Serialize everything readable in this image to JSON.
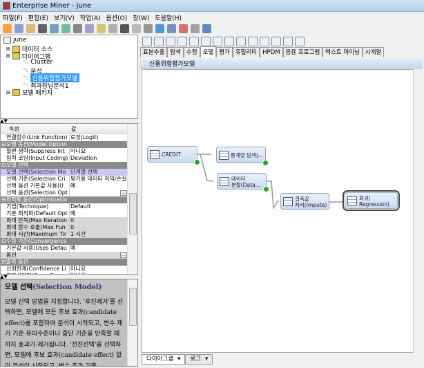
{
  "window": {
    "title": "Enterprise Miner - june"
  },
  "menu": [
    "파일(F)",
    "편집(E)",
    "보기(V)",
    "작업(A)",
    "옵션(O)",
    "창(W)",
    "도움말(H)"
  ],
  "tree": {
    "root": "june",
    "items": [
      {
        "label": "데이터 소스",
        "level": 1
      },
      {
        "label": "다이어그램",
        "level": 1
      },
      {
        "label": "Cluster",
        "level": 2
      },
      {
        "label": "분석",
        "level": 2
      },
      {
        "label": "신용위험평가모델",
        "level": 2,
        "selected": true
      },
      {
        "label": "최과장님분석1",
        "level": 2
      },
      {
        "label": "모델 패키지",
        "level": 1
      }
    ]
  },
  "properties": {
    "col_property": "속성",
    "col_value": "값",
    "rows": [
      {
        "k": "연결함수(Link Function)",
        "v": "로짓(Logit)"
      },
      {
        "k": "모델 옵션(Model Option",
        "group": true
      },
      {
        "k": "절편 생략(Suppress Int",
        "v": "아니요"
      },
      {
        "k": "입력 코딩(Input Coding)",
        "v": "Deviation"
      },
      {
        "k": "모델 선택",
        "group": true
      },
      {
        "k": "모델 선택(Selection Mo",
        "v": "단계별 선택",
        "selected": true
      },
      {
        "k": "선택 기준(Selection Cri",
        "v": "평가용 데이터 이익/손실"
      },
      {
        "k": "선택 옵션 기본값 사용(U",
        "v": "예"
      },
      {
        "k": "선택 옵션(Selection Opt",
        "v": "",
        "ellipsis": true
      },
      {
        "k": "최적화 옵션(Optimizatio",
        "group": true
      },
      {
        "k": "기법(Technique)",
        "v": "Default"
      },
      {
        "k": "기본 최적화(Default Opt",
        "v": "예"
      },
      {
        "k": "최대 반복(Max Iteration",
        "v": "0",
        "disabled": true
      },
      {
        "k": "최대 함수 호출(Max Fun",
        "v": "0",
        "disabled": true
      },
      {
        "k": "최대 시간(Maximum Tir",
        "v": "1 시간",
        "disabled": true
      },
      {
        "k": "수렴 기준(Convergence",
        "group": true
      },
      {
        "k": "기본값 사용(Uses Defau",
        "v": "예"
      },
      {
        "k": "옵션",
        "v": "",
        "ellipsis": true,
        "disabled": true
      },
      {
        "k": "출력 옵션",
        "group": true
      },
      {
        "k": "신뢰한계(Confidence Li",
        "v": "아니요"
      },
      {
        "k": "표본상자정(Save Cova",
        "v": "아니요"
      }
    ]
  },
  "help": {
    "title_ko": "모델 선택",
    "title_en": "(Selection Model)",
    "body": "모델 선택 방법을 지정합니다. '후진제거'를 선택하면, 모델에 모든 후보 효과(candidate effect)를 포함하여 분석이 시작되고, 변수 제거 기준 유의수준이나 중단 기준을 만족할 때까지 효과가 제거됩니다. '전진선택'을 선택하면, 모델에 후보 효과(candidate effect) 없이 분석이 시작되고, 변수 추가 기준"
  },
  "tabs": [
    "표본추출",
    "탐색",
    "수정",
    "모델",
    "평가",
    "유틸리티",
    "HPDM",
    "응용 프로그램",
    "텍스트 마이닝",
    "시계열"
  ],
  "active_tab": "모델",
  "diagram": {
    "title": "신용위험평가모델",
    "nodes": [
      {
        "id": "credit",
        "l1": "CREDIT",
        "l2": "",
        "done": true
      },
      {
        "id": "stat",
        "l1": "통계량 탐색|...",
        "l2": "",
        "done": true
      },
      {
        "id": "part",
        "l1": "데이터",
        "l2": "분할(Data...",
        "done": true
      },
      {
        "id": "impute",
        "l1": "결측값",
        "l2": "처리(Impute)",
        "done": false
      },
      {
        "id": "reg",
        "l1": "회귀|",
        "l2": "Regression)",
        "done": false,
        "selected": true
      }
    ]
  },
  "bottom_tabs": [
    "다이어그램",
    "로그"
  ]
}
